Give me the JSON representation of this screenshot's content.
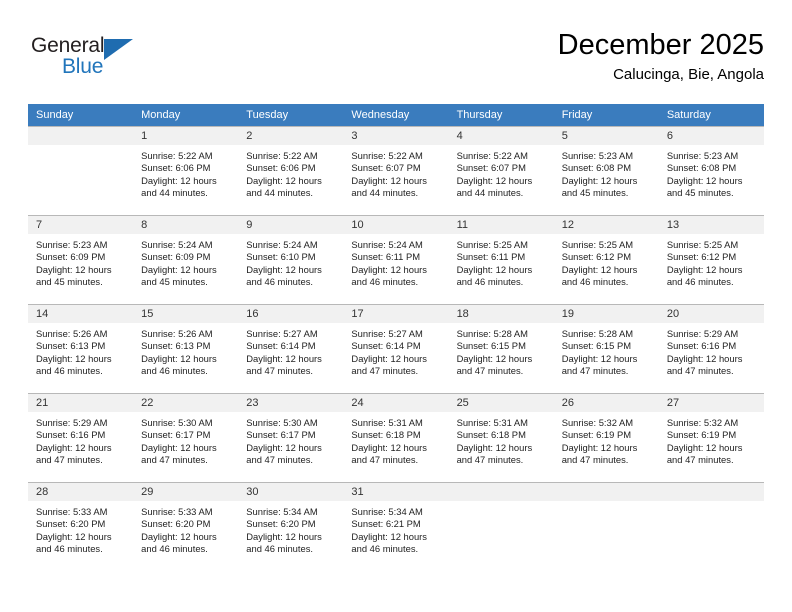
{
  "brand": {
    "name_top": "General",
    "name_bottom": "Blue",
    "triangle_icon": "triangle-icon",
    "color_dark": "#231f20",
    "color_blue": "#2175bb"
  },
  "header": {
    "month_title": "December 2025",
    "location": "Calucinga, Bie, Angola"
  },
  "theme": {
    "header_row_bg": "#3a7cbe",
    "daynum_band_bg": "#f1f1f1",
    "grid_line": "#b8b8b8",
    "text": "#222222"
  },
  "weekdays": [
    "Sunday",
    "Monday",
    "Tuesday",
    "Wednesday",
    "Thursday",
    "Friday",
    "Saturday"
  ],
  "calendar": {
    "weeks": [
      [
        {
          "day": "",
          "empty": true,
          "sunrise": "",
          "sunset": "",
          "daylight_1": "",
          "daylight_2": ""
        },
        {
          "day": "1",
          "sunrise": "Sunrise: 5:22 AM",
          "sunset": "Sunset: 6:06 PM",
          "daylight_1": "Daylight: 12 hours",
          "daylight_2": "and 44 minutes."
        },
        {
          "day": "2",
          "sunrise": "Sunrise: 5:22 AM",
          "sunset": "Sunset: 6:06 PM",
          "daylight_1": "Daylight: 12 hours",
          "daylight_2": "and 44 minutes."
        },
        {
          "day": "3",
          "sunrise": "Sunrise: 5:22 AM",
          "sunset": "Sunset: 6:07 PM",
          "daylight_1": "Daylight: 12 hours",
          "daylight_2": "and 44 minutes."
        },
        {
          "day": "4",
          "sunrise": "Sunrise: 5:22 AM",
          "sunset": "Sunset: 6:07 PM",
          "daylight_1": "Daylight: 12 hours",
          "daylight_2": "and 44 minutes."
        },
        {
          "day": "5",
          "sunrise": "Sunrise: 5:23 AM",
          "sunset": "Sunset: 6:08 PM",
          "daylight_1": "Daylight: 12 hours",
          "daylight_2": "and 45 minutes."
        },
        {
          "day": "6",
          "sunrise": "Sunrise: 5:23 AM",
          "sunset": "Sunset: 6:08 PM",
          "daylight_1": "Daylight: 12 hours",
          "daylight_2": "and 45 minutes."
        }
      ],
      [
        {
          "day": "7",
          "sunrise": "Sunrise: 5:23 AM",
          "sunset": "Sunset: 6:09 PM",
          "daylight_1": "Daylight: 12 hours",
          "daylight_2": "and 45 minutes."
        },
        {
          "day": "8",
          "sunrise": "Sunrise: 5:24 AM",
          "sunset": "Sunset: 6:09 PM",
          "daylight_1": "Daylight: 12 hours",
          "daylight_2": "and 45 minutes."
        },
        {
          "day": "9",
          "sunrise": "Sunrise: 5:24 AM",
          "sunset": "Sunset: 6:10 PM",
          "daylight_1": "Daylight: 12 hours",
          "daylight_2": "and 46 minutes."
        },
        {
          "day": "10",
          "sunrise": "Sunrise: 5:24 AM",
          "sunset": "Sunset: 6:11 PM",
          "daylight_1": "Daylight: 12 hours",
          "daylight_2": "and 46 minutes."
        },
        {
          "day": "11",
          "sunrise": "Sunrise: 5:25 AM",
          "sunset": "Sunset: 6:11 PM",
          "daylight_1": "Daylight: 12 hours",
          "daylight_2": "and 46 minutes."
        },
        {
          "day": "12",
          "sunrise": "Sunrise: 5:25 AM",
          "sunset": "Sunset: 6:12 PM",
          "daylight_1": "Daylight: 12 hours",
          "daylight_2": "and 46 minutes."
        },
        {
          "day": "13",
          "sunrise": "Sunrise: 5:25 AM",
          "sunset": "Sunset: 6:12 PM",
          "daylight_1": "Daylight: 12 hours",
          "daylight_2": "and 46 minutes."
        }
      ],
      [
        {
          "day": "14",
          "sunrise": "Sunrise: 5:26 AM",
          "sunset": "Sunset: 6:13 PM",
          "daylight_1": "Daylight: 12 hours",
          "daylight_2": "and 46 minutes."
        },
        {
          "day": "15",
          "sunrise": "Sunrise: 5:26 AM",
          "sunset": "Sunset: 6:13 PM",
          "daylight_1": "Daylight: 12 hours",
          "daylight_2": "and 46 minutes."
        },
        {
          "day": "16",
          "sunrise": "Sunrise: 5:27 AM",
          "sunset": "Sunset: 6:14 PM",
          "daylight_1": "Daylight: 12 hours",
          "daylight_2": "and 47 minutes."
        },
        {
          "day": "17",
          "sunrise": "Sunrise: 5:27 AM",
          "sunset": "Sunset: 6:14 PM",
          "daylight_1": "Daylight: 12 hours",
          "daylight_2": "and 47 minutes."
        },
        {
          "day": "18",
          "sunrise": "Sunrise: 5:28 AM",
          "sunset": "Sunset: 6:15 PM",
          "daylight_1": "Daylight: 12 hours",
          "daylight_2": "and 47 minutes."
        },
        {
          "day": "19",
          "sunrise": "Sunrise: 5:28 AM",
          "sunset": "Sunset: 6:15 PM",
          "daylight_1": "Daylight: 12 hours",
          "daylight_2": "and 47 minutes."
        },
        {
          "day": "20",
          "sunrise": "Sunrise: 5:29 AM",
          "sunset": "Sunset: 6:16 PM",
          "daylight_1": "Daylight: 12 hours",
          "daylight_2": "and 47 minutes."
        }
      ],
      [
        {
          "day": "21",
          "sunrise": "Sunrise: 5:29 AM",
          "sunset": "Sunset: 6:16 PM",
          "daylight_1": "Daylight: 12 hours",
          "daylight_2": "and 47 minutes."
        },
        {
          "day": "22",
          "sunrise": "Sunrise: 5:30 AM",
          "sunset": "Sunset: 6:17 PM",
          "daylight_1": "Daylight: 12 hours",
          "daylight_2": "and 47 minutes."
        },
        {
          "day": "23",
          "sunrise": "Sunrise: 5:30 AM",
          "sunset": "Sunset: 6:17 PM",
          "daylight_1": "Daylight: 12 hours",
          "daylight_2": "and 47 minutes."
        },
        {
          "day": "24",
          "sunrise": "Sunrise: 5:31 AM",
          "sunset": "Sunset: 6:18 PM",
          "daylight_1": "Daylight: 12 hours",
          "daylight_2": "and 47 minutes."
        },
        {
          "day": "25",
          "sunrise": "Sunrise: 5:31 AM",
          "sunset": "Sunset: 6:18 PM",
          "daylight_1": "Daylight: 12 hours",
          "daylight_2": "and 47 minutes."
        },
        {
          "day": "26",
          "sunrise": "Sunrise: 5:32 AM",
          "sunset": "Sunset: 6:19 PM",
          "daylight_1": "Daylight: 12 hours",
          "daylight_2": "and 47 minutes."
        },
        {
          "day": "27",
          "sunrise": "Sunrise: 5:32 AM",
          "sunset": "Sunset: 6:19 PM",
          "daylight_1": "Daylight: 12 hours",
          "daylight_2": "and 47 minutes."
        }
      ],
      [
        {
          "day": "28",
          "sunrise": "Sunrise: 5:33 AM",
          "sunset": "Sunset: 6:20 PM",
          "daylight_1": "Daylight: 12 hours",
          "daylight_2": "and 46 minutes."
        },
        {
          "day": "29",
          "sunrise": "Sunrise: 5:33 AM",
          "sunset": "Sunset: 6:20 PM",
          "daylight_1": "Daylight: 12 hours",
          "daylight_2": "and 46 minutes."
        },
        {
          "day": "30",
          "sunrise": "Sunrise: 5:34 AM",
          "sunset": "Sunset: 6:20 PM",
          "daylight_1": "Daylight: 12 hours",
          "daylight_2": "and 46 minutes."
        },
        {
          "day": "31",
          "sunrise": "Sunrise: 5:34 AM",
          "sunset": "Sunset: 6:21 PM",
          "daylight_1": "Daylight: 12 hours",
          "daylight_2": "and 46 minutes."
        },
        {
          "day": "",
          "empty": true,
          "sunrise": "",
          "sunset": "",
          "daylight_1": "",
          "daylight_2": ""
        },
        {
          "day": "",
          "empty": true,
          "sunrise": "",
          "sunset": "",
          "daylight_1": "",
          "daylight_2": ""
        },
        {
          "day": "",
          "empty": true,
          "sunrise": "",
          "sunset": "",
          "daylight_1": "",
          "daylight_2": ""
        }
      ]
    ]
  }
}
